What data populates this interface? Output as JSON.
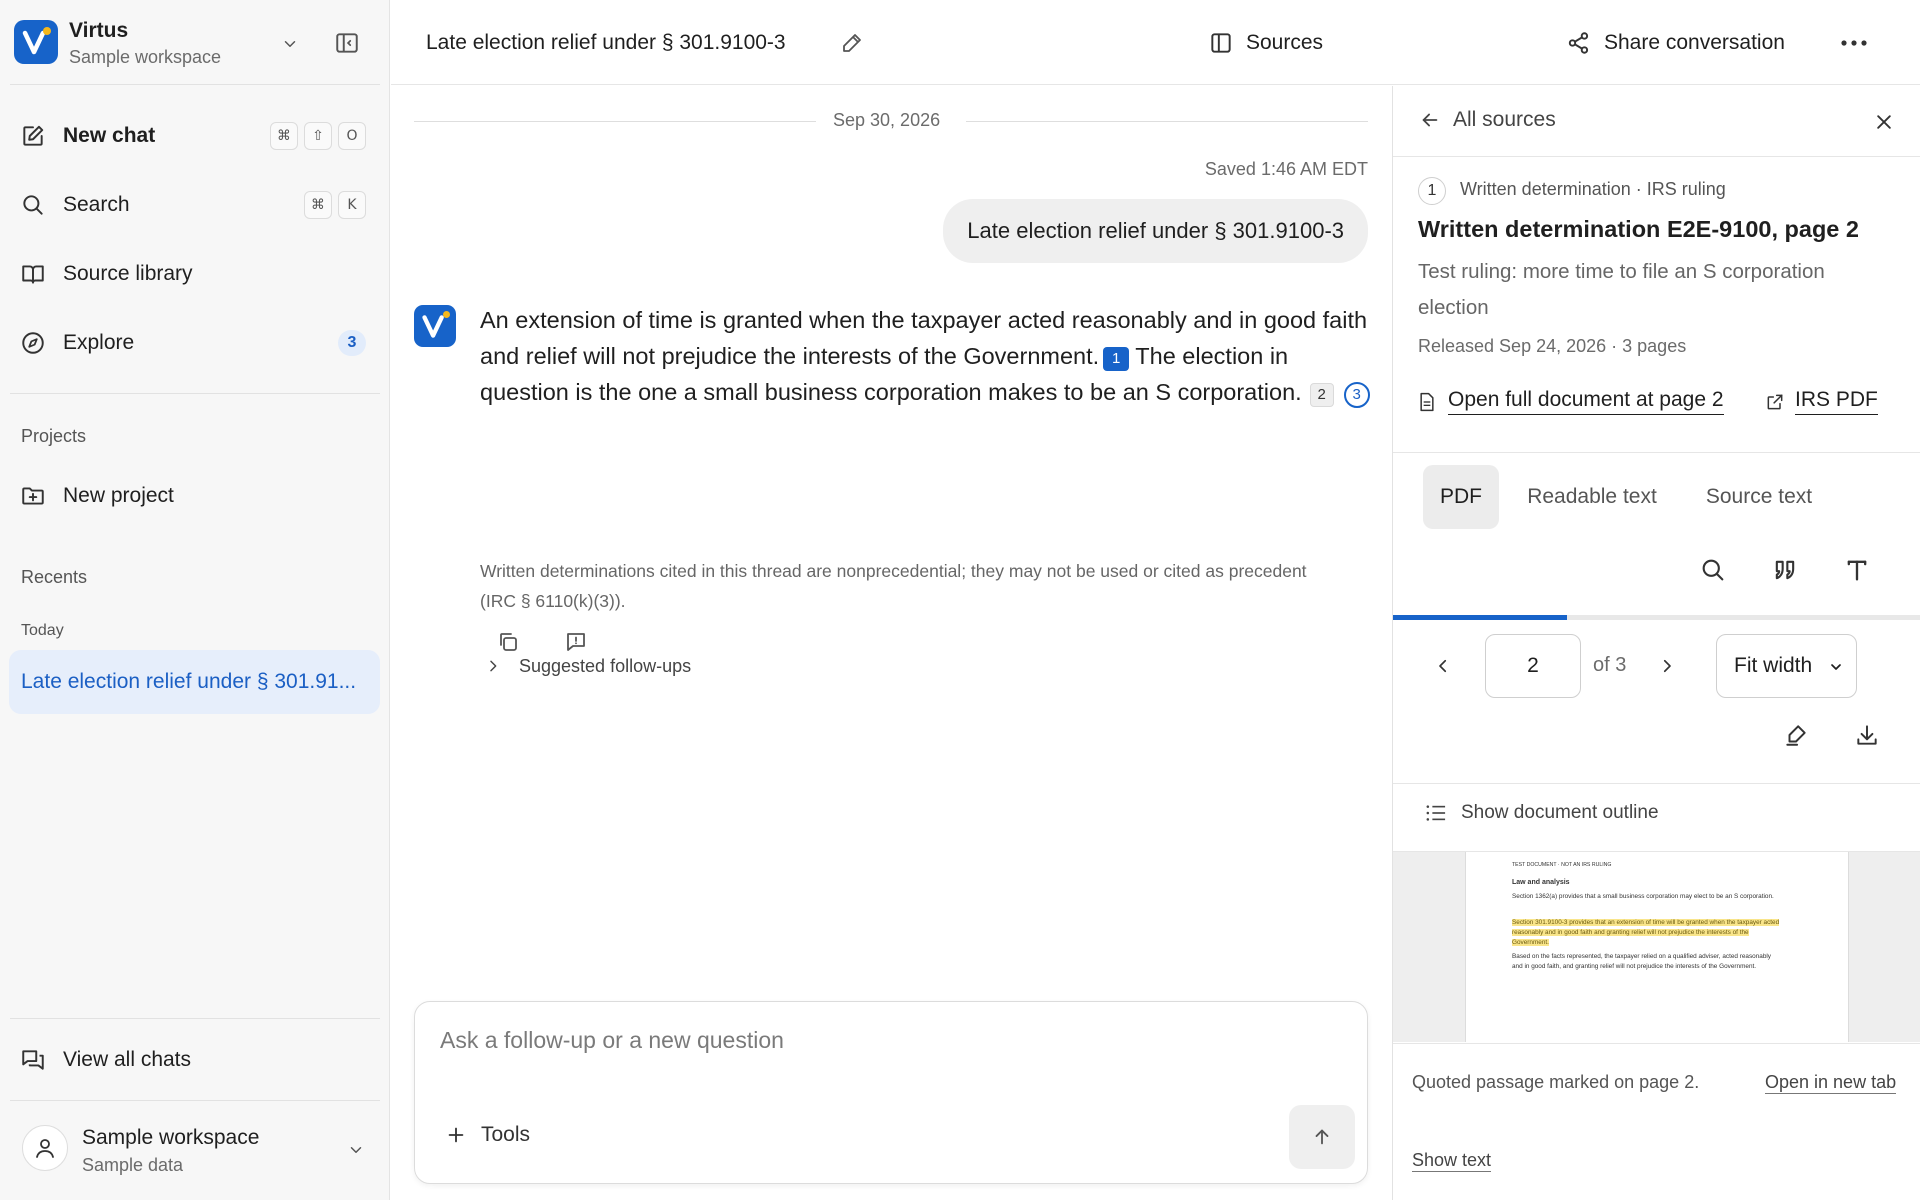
{
  "workspace": {
    "name": "Virtus",
    "subtitle": "Sample workspace"
  },
  "sidebar": {
    "new_chat": {
      "label": "New chat",
      "shortcut": [
        "⌘",
        "⇧",
        "O"
      ]
    },
    "search": {
      "label": "Search",
      "shortcut": [
        "⌘",
        "K"
      ]
    },
    "source_library": {
      "label": "Source library"
    },
    "explore": {
      "label": "Explore",
      "badge": "3"
    },
    "projects_label": "Projects",
    "new_project": "New project",
    "recents_label": "Recents",
    "today_label": "Today",
    "recent_items": [
      "Late election relief under § 301.91..."
    ],
    "view_all": "View all chats",
    "account": {
      "name": "Sample workspace",
      "sub": "Sample data"
    }
  },
  "header": {
    "title": "Late election relief under § 301.9100-3",
    "sources_label": "Sources",
    "share_label": "Share conversation"
  },
  "chat": {
    "date": "Sep 30, 2026",
    "saved": "Saved 1:46 AM EDT",
    "user_message": "Late election relief under § 301.9100-3",
    "answer_part1": "An extension of time is granted when the taxpayer acted reasonably and in good faith and relief will not prejudice the interests of the Government.",
    "cite1": "1",
    "answer_part2": " The election in question is the one a small business corporation makes to be an S corporation.",
    "cite2": "2",
    "cite3": "3",
    "note": "Written determinations cited in this thread are nonprecedential; they may not be used or cited as precedent (IRC § 6110(k)(3)).",
    "followups_label": "Suggested follow-ups",
    "composer_placeholder": "Ask a follow-up or a new question",
    "tools_label": "Tools"
  },
  "panel": {
    "back_label": "All sources",
    "source_number": "1",
    "source_kind": "Written determination · IRS ruling",
    "source_title": "Written determination E2E-9100, page 2",
    "source_desc": "Test ruling: more time to file an S corporation election",
    "source_meta": "Released Sep 24, 2026 · 3 pages",
    "open_full": "Open full document at page 2",
    "irs_pdf": "IRS PDF",
    "tabs": [
      "PDF",
      "Readable text",
      "Source text"
    ],
    "active_tab": "PDF",
    "page_current": "2",
    "page_total": "of 3",
    "progress": 0.33,
    "zoom": "Fit width",
    "outline_label": "Show document outline",
    "pdf_preview": {
      "header": "TEST DOCUMENT · NOT AN IRS RULING",
      "heading": "Law and analysis",
      "para1": "Section 1362(a) provides that a small business corporation may elect to be an S corporation.",
      "highlight": "Section 301.9100-3 provides that an extension of time will be granted when the taxpayer acted reasonably and in good faith and granting relief will not prejudice the interests of the Government.",
      "para2": "Based on the facts represented, the taxpayer relied on a qualified adviser, acted reasonably and in good faith, and granting relief will not prejudice the interests of the Government."
    },
    "quoted_note": "Quoted passage marked on page 2.",
    "open_new_tab": "Open in new tab",
    "show_text": "Show text"
  },
  "colors": {
    "accent": "#1763c9",
    "logo_dot": "#f5b81c",
    "highlight": "#f9e58a"
  }
}
